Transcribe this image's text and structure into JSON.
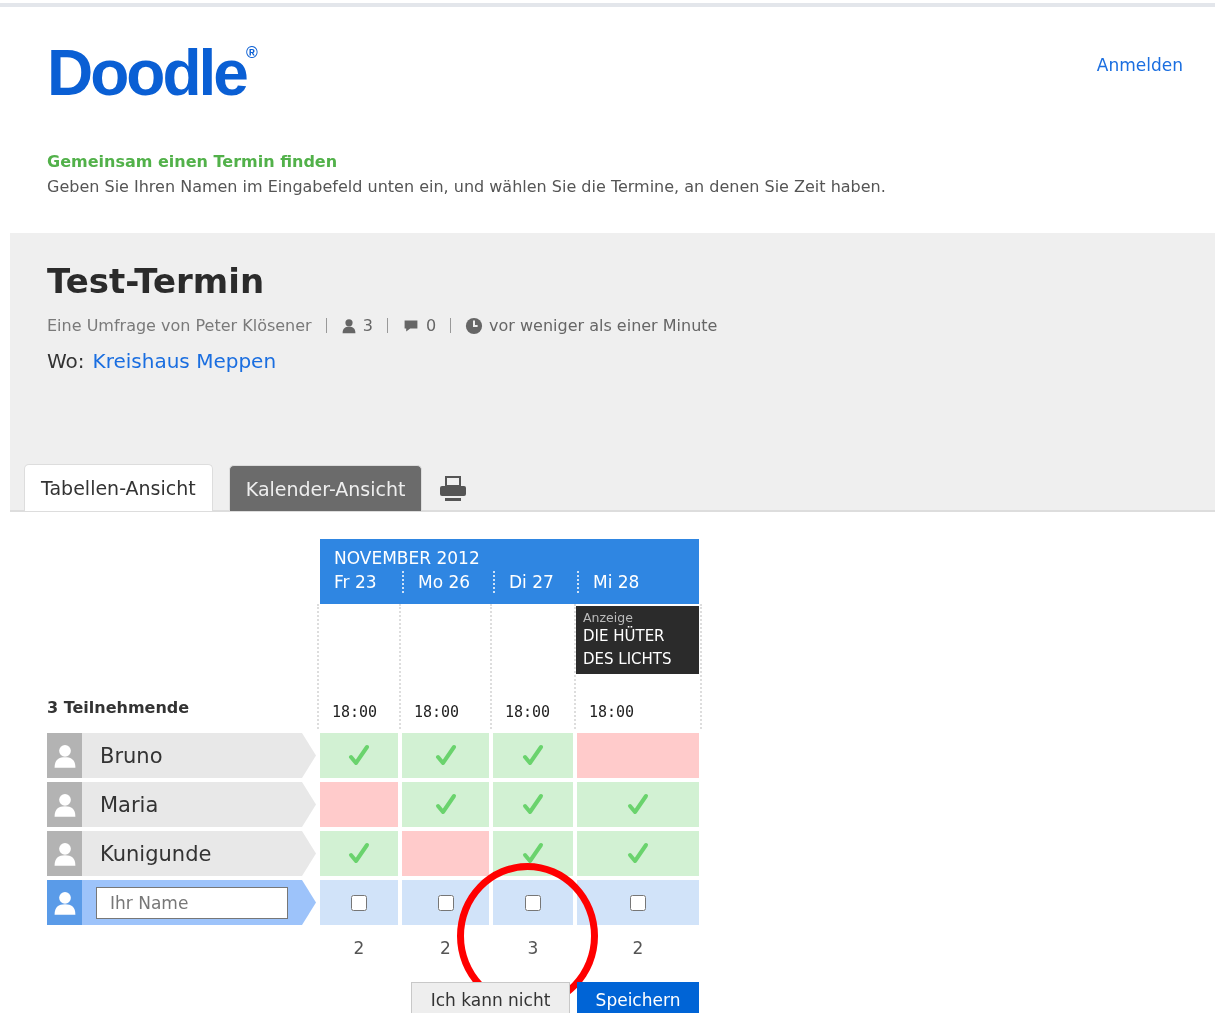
{
  "header": {
    "logo": "Doodle$^{®}$",
    "login_link": "Anmelden"
  },
  "intro": {
    "heading": "Gemeinsam einen Termin finden",
    "text": "Geben Sie Ihren Namen im Eingabefeld unten ein, und wählen Sie die Termine, an denen Sie Zeit haben."
  },
  "poll": {
    "title": "Test-Termin",
    "author": "Eine Umfrage von Peter Klösener",
    "participant_count": "3",
    "comment_count": "0",
    "created": "vor weniger als einer Minute",
    "location_label": "Wo:",
    "location": "Kreishaus Meppen"
  },
  "tabs": [
    {
      "label": "Tabellen-Ansicht",
      "selected": true
    },
    {
      "label": "Kalender-Ansicht",
      "selected": false
    }
  ],
  "table": {
    "month": "NOVEMBER 2012",
    "participants_label": "3 Teilnehmende",
    "columns": [
      {
        "day": "Fr 23",
        "time": "18:00"
      },
      {
        "day": "Mo 26",
        "time": "18:00"
      },
      {
        "day": "Di 27",
        "time": "18:00"
      },
      {
        "day": "Mi 28",
        "time": "18:00",
        "ad": {
          "label": "Anzeige",
          "lines": [
            "DIE HÜTER",
            "DES LICHTS"
          ]
        }
      }
    ],
    "participants": [
      {
        "name": "Bruno",
        "votes": [
          true,
          true,
          true,
          false
        ]
      },
      {
        "name": "Maria",
        "votes": [
          false,
          true,
          true,
          true
        ]
      },
      {
        "name": "Kunigunde",
        "votes": [
          true,
          false,
          true,
          true
        ]
      }
    ],
    "new_row": {
      "placeholder": "Ihr Name",
      "checkboxes": [
        {
          "checked": false
        },
        {
          "checked": false
        },
        {
          "checked": false
        },
        {
          "checked": false
        }
      ]
    },
    "counts": [
      "2",
      "2",
      "3",
      "2"
    ],
    "buttons": [
      {
        "label": "Ich kann nicht",
        "kind": "secondary"
      },
      {
        "label": "Speichern",
        "kind": "primary"
      }
    ]
  },
  "annotation": {
    "kind": "circle"
  }
}
